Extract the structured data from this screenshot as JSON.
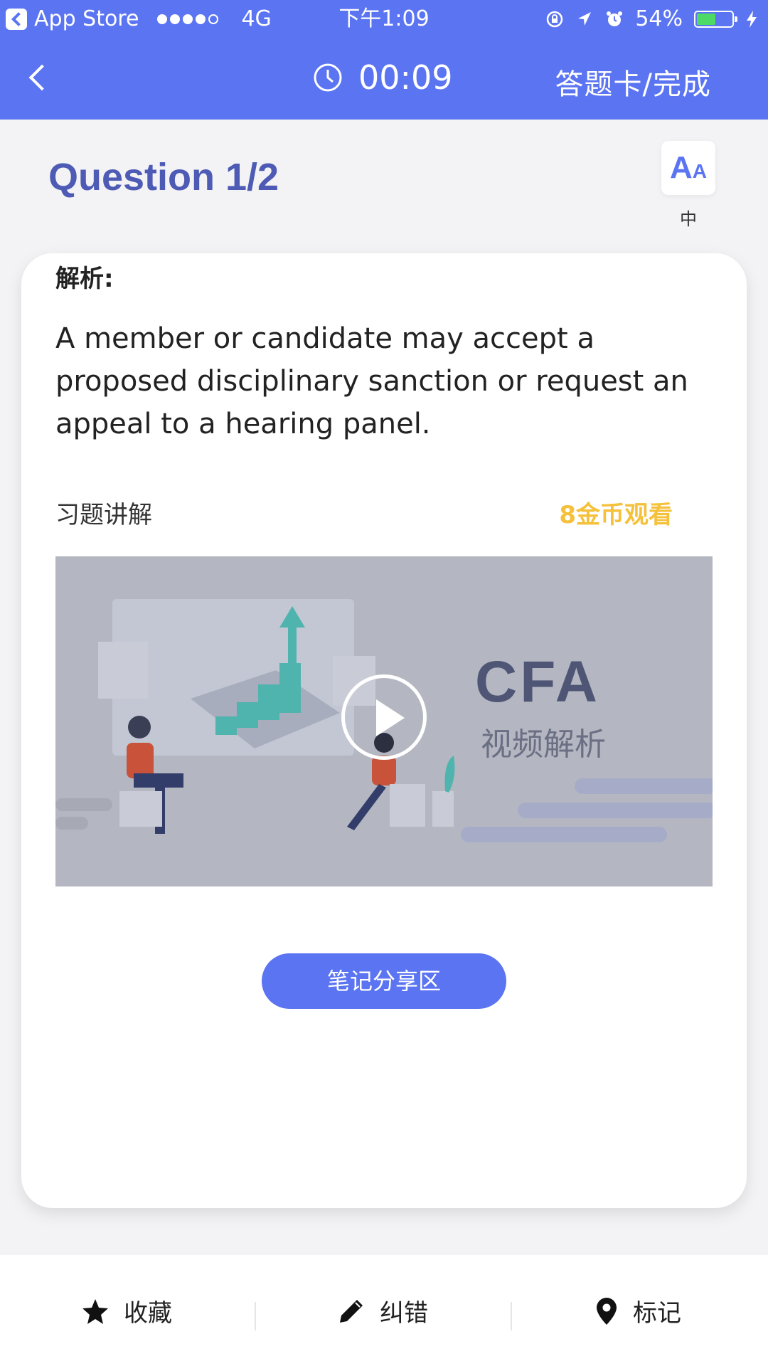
{
  "status_bar": {
    "app_name": "App Store",
    "network": "4G",
    "time": "下午1:09",
    "battery": "54%",
    "battery_level": 0.54
  },
  "nav": {
    "timer": "00:09",
    "right_action": "答题卡/完成"
  },
  "question": {
    "title": "Question 1/2",
    "font_size_label": "中",
    "font_button_text": "AA"
  },
  "analysis": {
    "label": "解析:",
    "text": "A member or candidate may accept a proposed disciplinary sanction or request an appeal to a hearing panel."
  },
  "video_section": {
    "label": "习题讲解",
    "coins_label": "8金币观看",
    "thumb_title": "CFA",
    "thumb_subtitle": "视频解析"
  },
  "notes_button": "笔记分享区",
  "bottom_bar": {
    "favorite": "收藏",
    "report_error": "纠错",
    "mark": "标记"
  },
  "colors": {
    "primary": "#5b74f2",
    "coins": "#f5c03a",
    "title": "#4e5bb5"
  }
}
